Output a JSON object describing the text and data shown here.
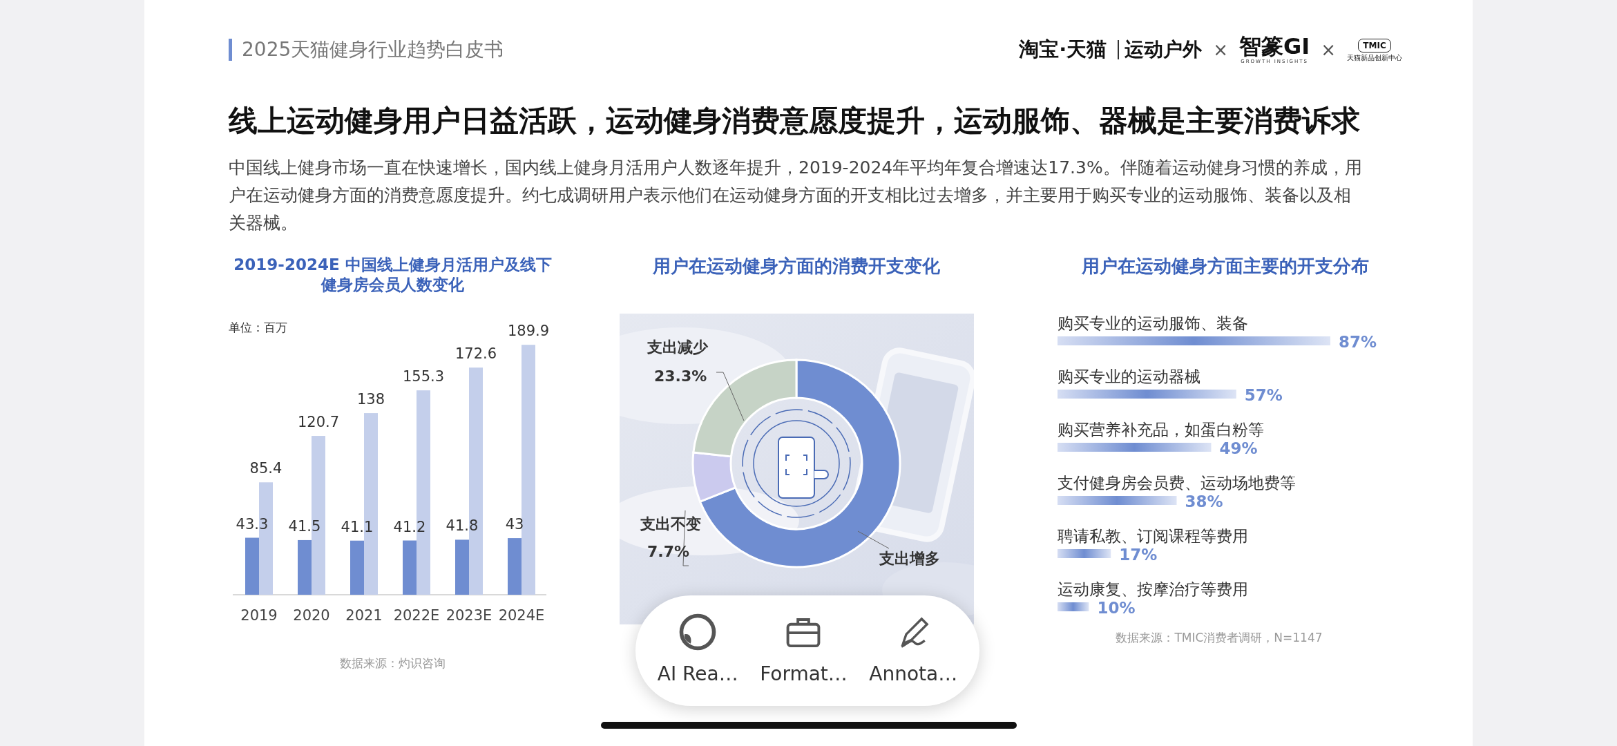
{
  "header": {
    "report_title": "2025天猫健身行业趋势白皮书",
    "logos": [
      {
        "kind": "wordmark",
        "text": "淘宝·天猫"
      },
      {
        "kind": "segment",
        "text": "运动户外"
      },
      {
        "kind": "times",
        "text": "×"
      },
      {
        "kind": "stacked",
        "text": "智篆GI",
        "subtext": "GROWTH INSIGHTS"
      },
      {
        "kind": "times",
        "text": "×"
      },
      {
        "kind": "badge",
        "text": "TMIC",
        "subtext": "天猫新品创新中心"
      }
    ]
  },
  "headline": "线上运动健身用户日益活跃，运动健身消费意愿度提升，运动服饰、器械是主要消费诉求",
  "summary": "中国线上健身市场一直在快速增长，国内线上健身月活用户人数逐年提升，2019-2024年平均年复合增速达17.3%。伴随着运动健身习惯的养成，用户在运动健身方面的消费意愿度提升。约七成调研用户表示他们在运动健身方面的开支相比过去增多，并主要用于购买专业的运动服饰、装备以及相关器械。",
  "panels": [
    {
      "unit": "单位：百万",
      "source": "数据来源：灼识咨询",
      "chart_data": {
        "type": "bar",
        "title": "2019-2024E 中国线上健身月活用户及线下健身房会员人数变化",
        "categories": [
          "2019",
          "2020",
          "2021",
          "2022E",
          "2023E",
          "2024E"
        ],
        "data_labels": true,
        "series": [
          {
            "color": "#6f8dd1",
            "values": [
              43.3,
              41.5,
              41.1,
              41.2,
              41.8,
              43
            ]
          },
          {
            "color": "#c4cfeb",
            "values": [
              85.4,
              120.7,
              138,
              155.3,
              172.6,
              189.9
            ]
          }
        ]
      }
    },
    {
      "slices": [
        {
          "color": "#6f8dd1"
        },
        {
          "color": "#cbcaee"
        },
        {
          "color": "#c6d3c6"
        }
      ],
      "chart_data": {
        "type": "donut",
        "title": "用户在运动健身方面的消费开支变化",
        "categories": [
          "支出增多",
          "支出不变",
          "支出减少"
        ],
        "values": [
          69,
          7.7,
          23.3
        ],
        "value_labels": [
          null,
          "7.7%",
          "23.3%"
        ]
      }
    },
    {
      "source": "数据来源：TMIC消费者调研，N=1147",
      "chart_data": {
        "type": "bar",
        "orientation": "horizontal",
        "title": "用户在运动健身方面主要的开支分布",
        "categories": [
          "购买专业的运动服饰、装备",
          "购买专业的运动器械",
          "购买营养补充品，如蛋白粉等",
          "支付健身房会员费、运动场地费等",
          "聘请私教、订阅课程等费用",
          "运动康复、按摩治疗等费用"
        ],
        "values": [
          87,
          57,
          49,
          38,
          17,
          10
        ],
        "value_labels": [
          "87%",
          "57%",
          "49%",
          "38%",
          "17%",
          "10%"
        ]
      }
    }
  ],
  "toolbar": {
    "buttons": [
      {
        "kind": "ai",
        "label": "AI Rea…"
      },
      {
        "kind": "format",
        "label": "Format…"
      },
      {
        "kind": "annotate",
        "label": "Annota…"
      }
    ]
  }
}
